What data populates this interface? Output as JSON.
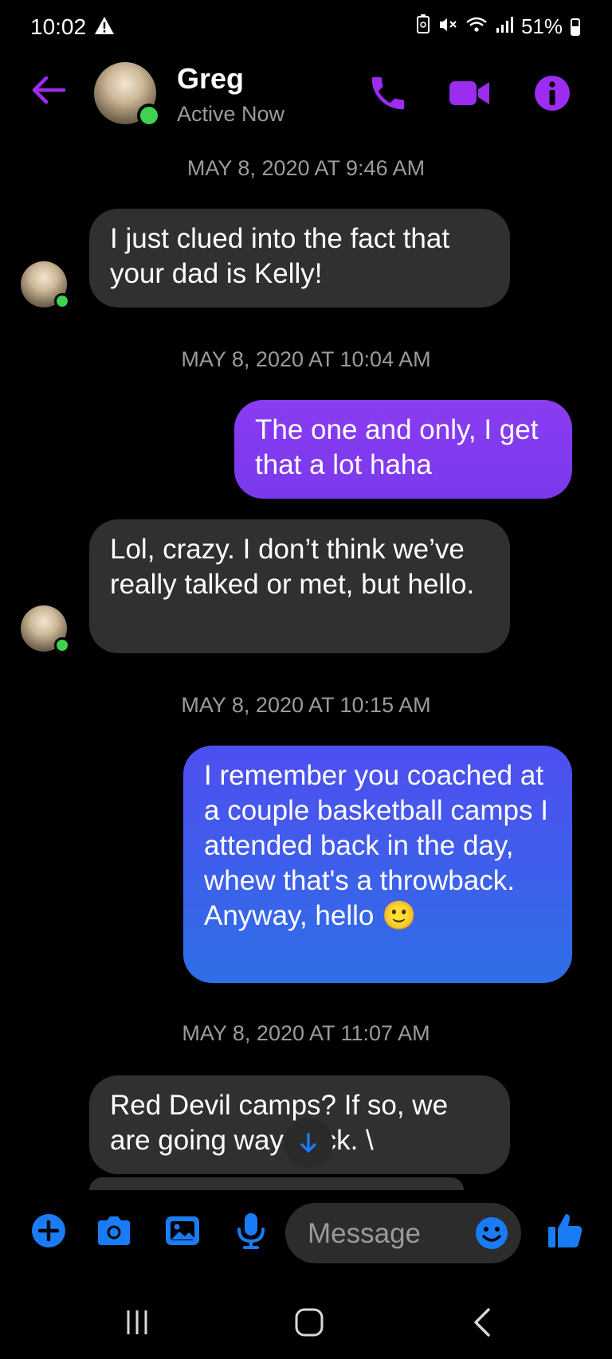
{
  "status_bar": {
    "time": "10:02",
    "battery": "51%"
  },
  "header": {
    "contact_name": "Greg",
    "status": "Active Now"
  },
  "messages": [
    {
      "type": "timestamp",
      "text": "MAY 8, 2020 AT 9:46 AM"
    },
    {
      "type": "incoming",
      "text": "I just clued into the fact that your dad is Kelly!"
    },
    {
      "type": "timestamp",
      "text": "MAY 8, 2020 AT 10:04 AM"
    },
    {
      "type": "outgoing",
      "text": "The one and only, I get that a lot haha"
    },
    {
      "type": "incoming",
      "text": "Lol, crazy. I don’t think we’ve really talked or met, but hello."
    },
    {
      "type": "timestamp",
      "text": "MAY 8, 2020 AT 10:15 AM"
    },
    {
      "type": "outgoing",
      "text": "I remember you coached at a couple basketball camps I attended back in the day, whew that's a throwback. Anyway, hello 🙂"
    },
    {
      "type": "timestamp",
      "text": "MAY 8, 2020 AT 11:07 AM"
    },
    {
      "type": "incoming",
      "text": "Red Devil camps? If so, we are going way back. \\"
    }
  ],
  "composer": {
    "placeholder": "Message"
  },
  "colors": {
    "accent_purple": "#9b2cf0",
    "accent_blue": "#1a7cf5",
    "online_green": "#3fd14f",
    "incoming_bubble": "#303030"
  },
  "icons": {
    "header": [
      "back-arrow-icon",
      "phone-icon",
      "video-camera-icon",
      "info-icon"
    ],
    "composer": [
      "plus-icon",
      "camera-icon",
      "gallery-icon",
      "microphone-icon",
      "emoji-icon",
      "thumbs-up-icon"
    ],
    "nav": [
      "recents-icon",
      "home-icon",
      "back-icon"
    ]
  }
}
